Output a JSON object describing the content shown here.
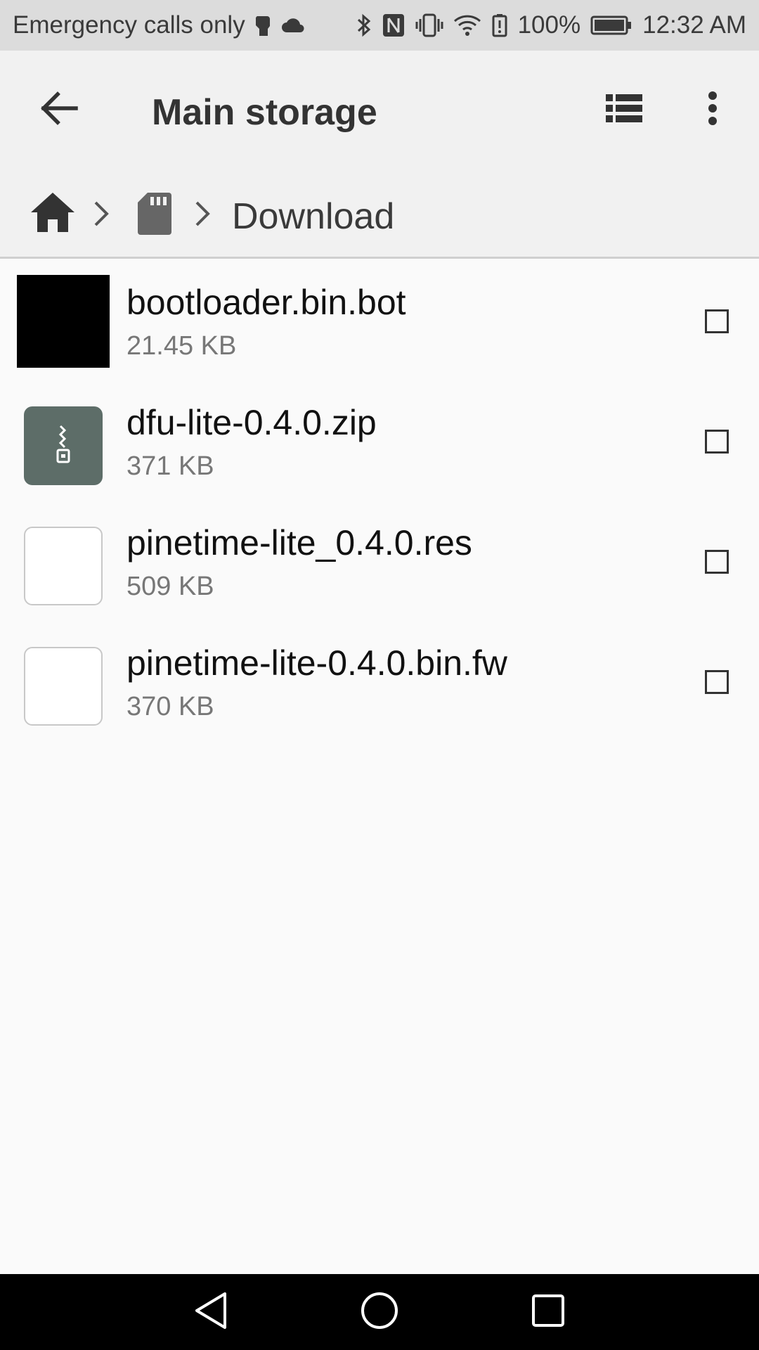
{
  "status_bar": {
    "carrier_text": "Emergency calls only",
    "battery_percent": "100%",
    "time": "12:32 AM",
    "icons": [
      "fist-notification-icon",
      "cloud-icon",
      "bluetooth-icon",
      "nfc-icon",
      "vibrate-icon",
      "wifi-icon",
      "battery-saver-icon",
      "battery-icon"
    ]
  },
  "app_bar": {
    "title": "Main storage",
    "icons": [
      "back-arrow-icon",
      "list-view-icon",
      "more-vert-icon"
    ]
  },
  "breadcrumb": {
    "icons": [
      "home-icon",
      "chevron-right-icon",
      "sd-card-icon",
      "chevron-right-icon"
    ],
    "current": "Download"
  },
  "files": [
    {
      "name": "bootloader.bin.bot",
      "size": "21.45 KB",
      "thumb": "black-thumbnail",
      "checked": false
    },
    {
      "name": "dfu-lite-0.4.0.zip",
      "size": "371 KB",
      "thumb": "zip-icon",
      "checked": false
    },
    {
      "name": "pinetime-lite_0.4.0.res",
      "size": "509 KB",
      "thumb": "blank-file",
      "checked": false
    },
    {
      "name": "pinetime-lite-0.4.0.bin.fw",
      "size": "370 KB",
      "thumb": "blank-file",
      "checked": false
    }
  ],
  "nav_bar": {
    "icons": [
      "nav-back-icon",
      "nav-home-icon",
      "nav-recents-icon"
    ]
  },
  "colors": {
    "status_bar_bg": "#dcdcdc",
    "app_bar_bg": "#f1f1f1",
    "page_bg": "#fafafa",
    "zip_thumb": "#5d6d68",
    "nav_bar_bg": "#000000"
  }
}
